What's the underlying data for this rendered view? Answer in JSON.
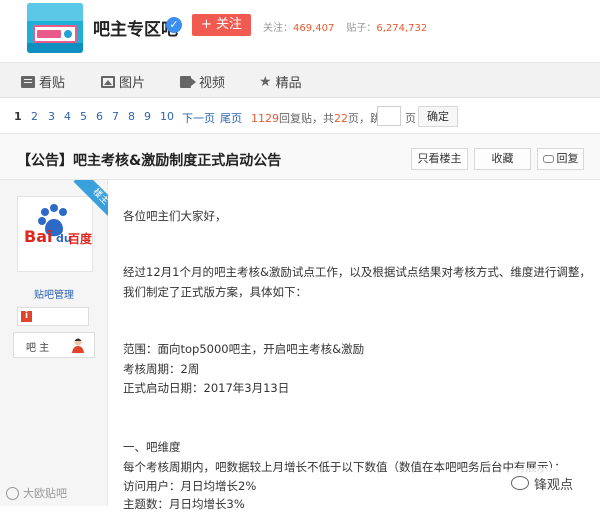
{
  "header": {
    "forum_name": "吧主专区吧",
    "follow_label": "+ 关注",
    "follow_count_label": "关注：",
    "follow_count": "469,407",
    "post_count_label": "贴子：",
    "post_count": "6,274,732",
    "verified_icon": "verified-check-icon",
    "logo_icon": "forum-logo-icon"
  },
  "tabs": [
    {
      "label": "看贴",
      "icon": "post-icon"
    },
    {
      "label": "图片",
      "icon": "image-icon"
    },
    {
      "label": "视频",
      "icon": "video-icon"
    },
    {
      "label": "精品",
      "icon": "star-icon"
    }
  ],
  "pagination": {
    "pages": [
      "1",
      "2",
      "3",
      "4",
      "5",
      "6",
      "7",
      "8",
      "9",
      "10"
    ],
    "current": "1",
    "next_label": "下一页",
    "last_label": "尾页",
    "reply_count": "1129",
    "reply_suffix": "回复贴，共",
    "page_total": "22",
    "page_suffix": "页，跳到",
    "page_unit": "页",
    "confirm_label": "确定"
  },
  "thread": {
    "title": "【公告】吧主考核&激励制度正式启动公告",
    "only_owner_label": "只看楼主",
    "favorite_label": "收藏",
    "reply_label": "回复"
  },
  "author": {
    "badge": "楼主",
    "name": "贴吧管理",
    "level_icon": "i",
    "role": "吧 主",
    "avatar_text": "Bai du 百度"
  },
  "post": {
    "lines": [
      "各位吧主们大家好，",
      "经过12月1个月的吧主考核&激励试点工作，以及根据试点结果对考核方式、维度进行调整，",
      "我们制定了正式版方案，具体如下：",
      "范围：面向top5000吧主，开启吧主考核&激励",
      "考核周期：2周",
      "正式启动日期：2017年3月13日",
      "一、吧维度",
      "每个考核周期内，吧数据较上月增长不低于以下数值（数值在本吧吧务后台中有展示）：",
      "访问用户：月日均增长2%",
      "主题数：月日均增长3%"
    ]
  },
  "watermark": {
    "left": "大欧贴吧",
    "right": "锋观点"
  }
}
